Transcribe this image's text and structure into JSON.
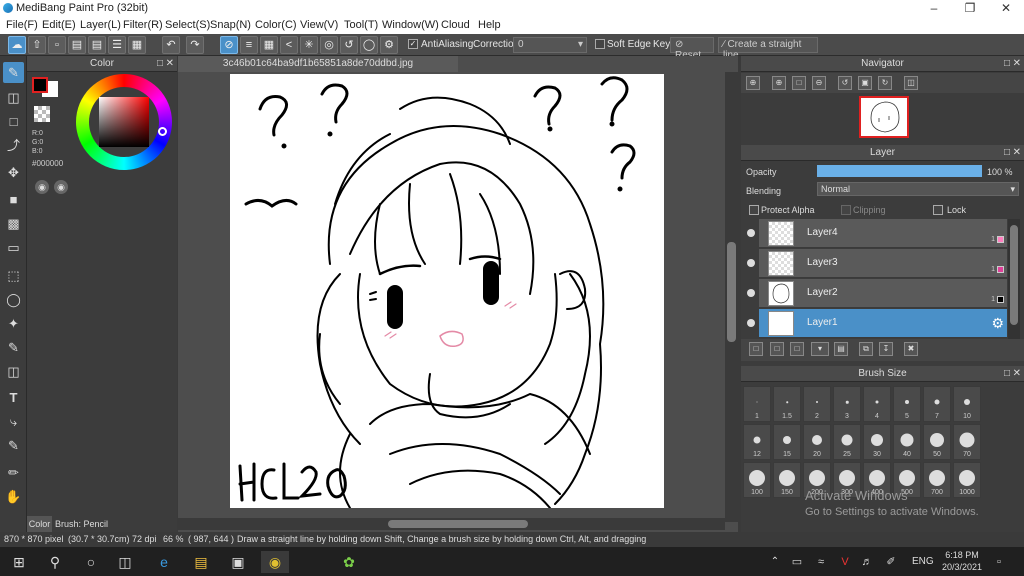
{
  "app": {
    "title": "MediBang Paint Pro (32bit)"
  },
  "menu": [
    "File(F)",
    "Edit(E)",
    "Layer(L)",
    "Filter(R)",
    "Select(S)",
    "Snap(N)",
    "Color(C)",
    "View(V)",
    "Tool(T)",
    "Window(W)",
    "Cloud",
    "Help"
  ],
  "toolbar": {
    "antialiasing": "AntiAliasing",
    "correction_label": "Correction",
    "correction_value": "0",
    "soft_edge": "Soft Edge",
    "key_label": "Key",
    "reset": "Reset",
    "create_line": "Create a straight line"
  },
  "color_panel": {
    "title": "Color",
    "r": "R:0",
    "g": "G:0",
    "b": "B:0",
    "hex": "#000000",
    "fg_color": "#000000",
    "bg_color": "#ffffff",
    "accent": "#e02020"
  },
  "bottom_tabs": {
    "color": "Color",
    "brush": "Brush: Pencil"
  },
  "document": {
    "filename": "3c46b01c64ba9df1b65851a8de70ddbd.jpg",
    "signature": "HCL20"
  },
  "navigator": {
    "title": "Navigator"
  },
  "layer_panel": {
    "title": "Layer",
    "opacity_label": "Opacity",
    "opacity_value": "100 %",
    "opacity_fraction": 1.0,
    "blending_label": "Blending",
    "blending_value": "Normal",
    "protect_alpha": "Protect Alpha",
    "clipping": "Clipping",
    "lock": "Lock",
    "layers": [
      {
        "name": "Layer4",
        "num": "1",
        "color": "#ff7fbf"
      },
      {
        "name": "Layer3",
        "num": "1",
        "color": "#e0409a"
      },
      {
        "name": "Layer2",
        "num": "1",
        "color": "#000000"
      },
      {
        "name": "Layer1",
        "num": "1",
        "color": "#ffffff"
      }
    ]
  },
  "brush_size": {
    "title": "Brush Size",
    "sizes": [
      "1",
      "1.5",
      "2",
      "3",
      "4",
      "5",
      "7",
      "10",
      "12",
      "15",
      "20",
      "25",
      "30",
      "40",
      "50",
      "70",
      "100",
      "150",
      "200",
      "300",
      "400",
      "500",
      "700",
      "1000"
    ]
  },
  "watermark": {
    "line1": "Activate Windows",
    "line2": "Go to Settings to activate Windows."
  },
  "status": {
    "size": "870 * 870 pixel",
    "cm": "(30.7 * 30.7cm)",
    "dpi": "72 dpi",
    "zoom": "66 %",
    "coord": "( 987, 644 )",
    "hint": "Draw a straight line by holding down Shift, Change a brush size by holding down Ctrl, Alt, and dragging"
  },
  "taskbar": {
    "lang": "ENG",
    "time": "6:18 PM",
    "date": "20/3/2021"
  }
}
